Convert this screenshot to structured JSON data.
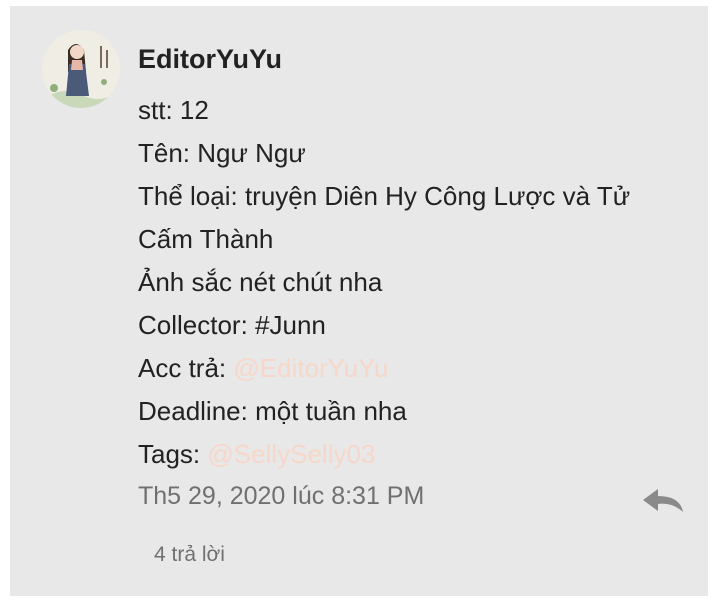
{
  "comment": {
    "author": "EditorYuYu",
    "lines": [
      "stt: 12",
      "Tên: Ngư Ngư",
      "Thể loại: truyện Diên Hy Công Lược và Tử Cấm Thành",
      "Ảnh sắc nét chút nha",
      "Collector: #Junn"
    ],
    "acc_label": "Acc trả: ",
    "acc_mention": "@EditorYuYu",
    "deadline": "Deadline: một tuần nha",
    "tags_label": "Tags: ",
    "tags_mention": "@SellySelly03",
    "timestamp": "Th5 29, 2020 lúc 8:31 PM",
    "replies": "4 trả lời"
  },
  "colors": {
    "card_bg": "#e8e8e8",
    "text": "#222222",
    "muted": "#707070",
    "mention": "#f7d7c9"
  },
  "icons": {
    "avatar": "avatar-illustration",
    "reply": "reply-arrow-icon"
  }
}
